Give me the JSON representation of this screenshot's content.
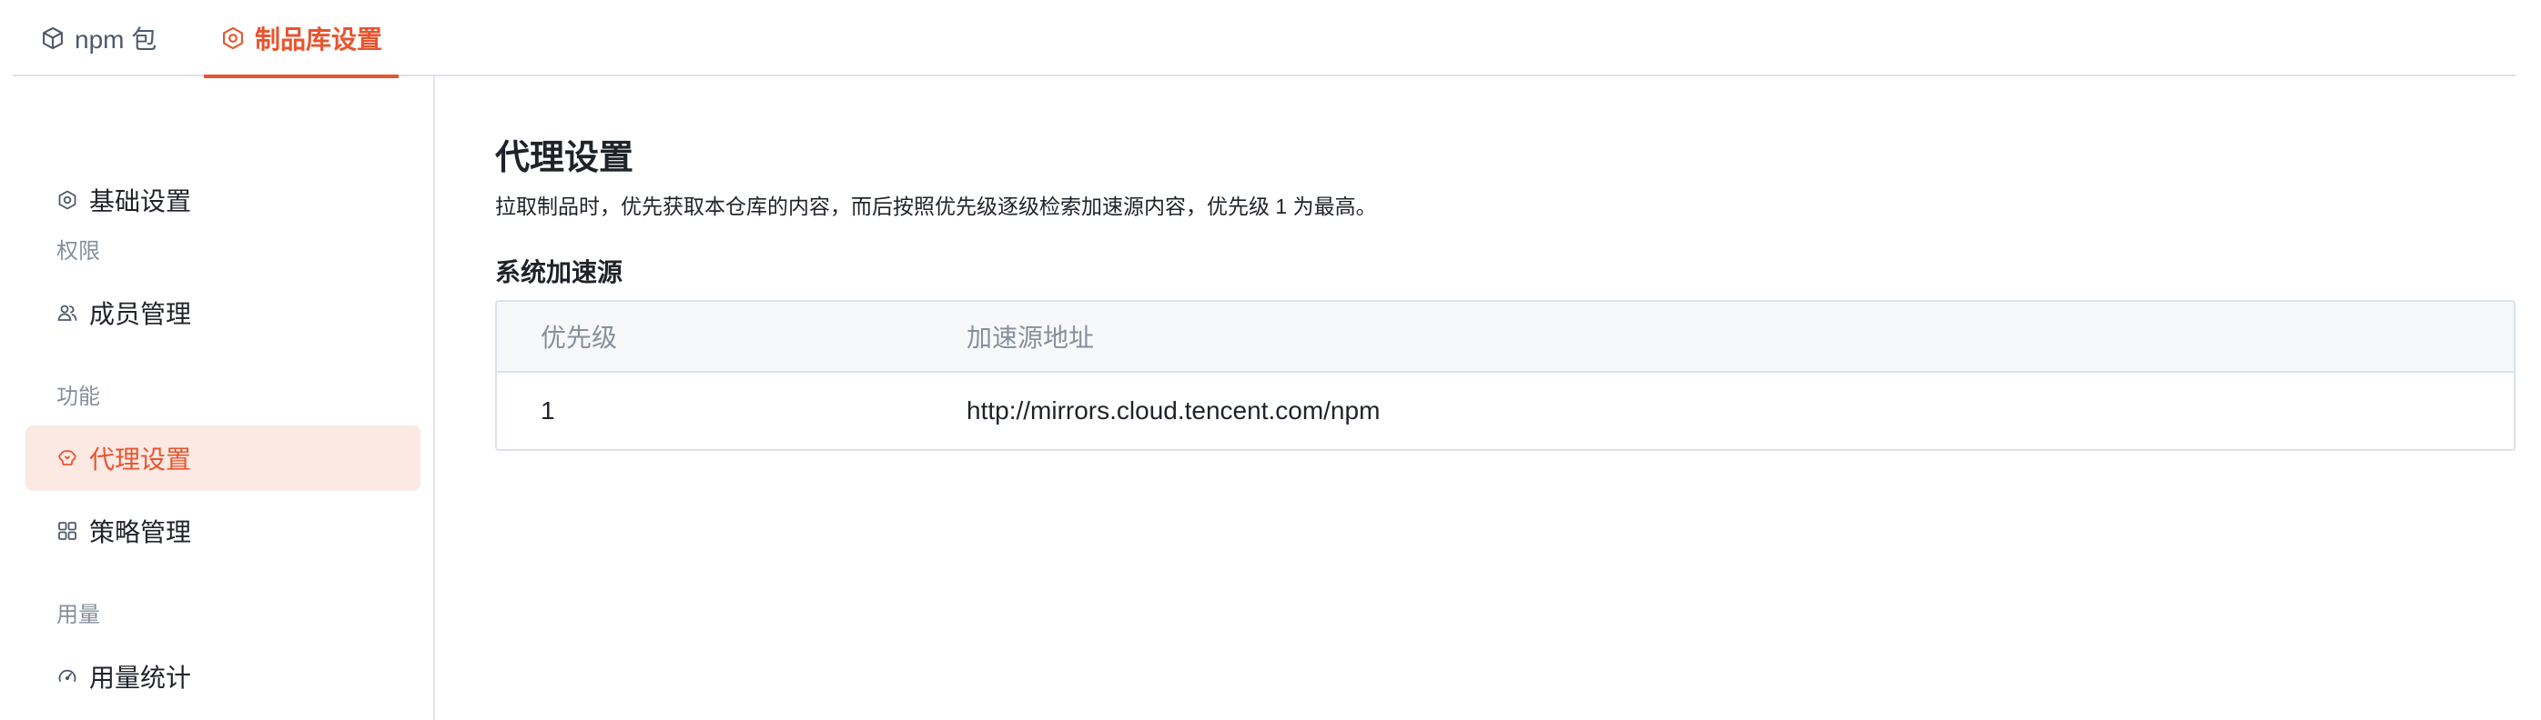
{
  "tabs": [
    {
      "label": "npm 包",
      "icon": "package-icon",
      "active": false
    },
    {
      "label": "制品库设置",
      "icon": "settings-icon",
      "active": true
    }
  ],
  "sidebar": {
    "items": [
      {
        "label": "基础设置",
        "icon": "settings-icon"
      },
      {
        "label": "成员管理",
        "icon": "users-icon"
      },
      {
        "label": "代理设置",
        "icon": "proxy-icon",
        "active": true
      },
      {
        "label": "策略管理",
        "icon": "grid-icon"
      },
      {
        "label": "用量统计",
        "icon": "gauge-icon"
      }
    ],
    "groups": [
      "权限",
      "功能",
      "用量"
    ]
  },
  "main": {
    "title": "代理设置",
    "description": "拉取制品时，优先获取本仓库的内容，而后按照优先级逐级检索加速源内容，优先级 1 为最高。",
    "section_title": "系统加速源",
    "table": {
      "headers": [
        "优先级",
        "加速源地址"
      ],
      "rows": [
        {
          "priority": "1",
          "url": "http://mirrors.cloud.tencent.com/npm"
        }
      ]
    }
  },
  "colors": {
    "accent": "#e8542e",
    "active_bg": "#fce9e3",
    "muted": "#86909c",
    "border": "#dde1ea"
  }
}
